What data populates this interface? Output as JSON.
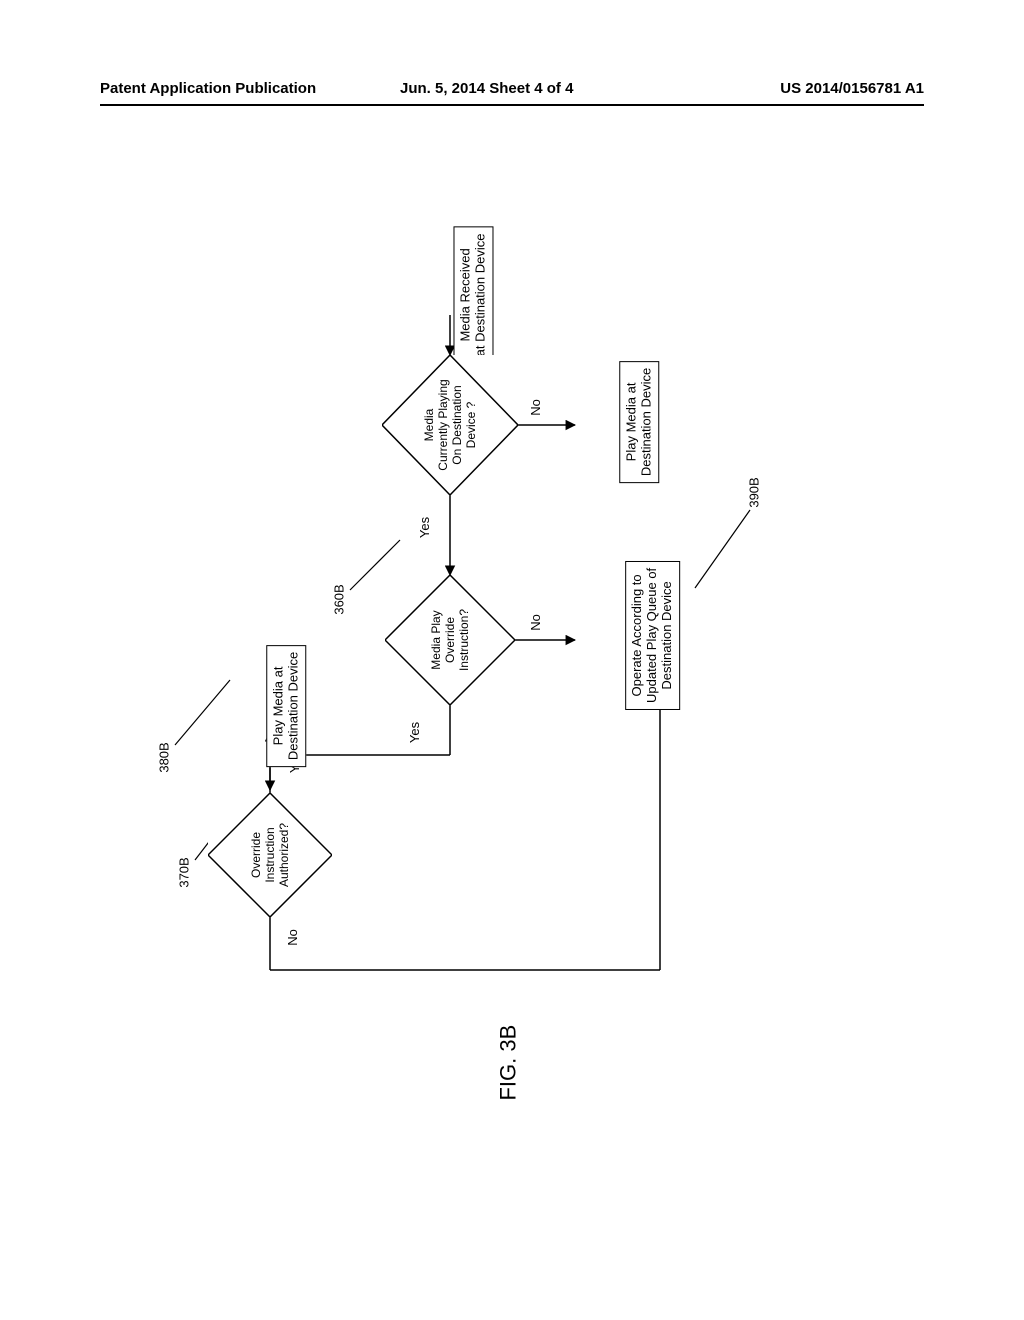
{
  "header": {
    "left": "Patent Application Publication",
    "center": "Jun. 5, 2014   Sheet 4 of 4",
    "right": "US 2014/0156781 A1"
  },
  "figure_label": "FIG. 3B",
  "nodes": {
    "start": "Media Received\nat Destination Device",
    "d1": "Media\nCurrently Playing\nOn Destination\nDevice ?",
    "play_no": "Play Media at\nDestination Device",
    "d2": "Media Play\nOverride\nInstruction?",
    "operate": "Operate According to\nUpdated Play Queue of\nDestination Device",
    "d3": "Override\nInstruction\nAuthorized?",
    "play_yes": "Play Media at\nDestination Device"
  },
  "edge_labels": {
    "yes": "Yes",
    "no": "No"
  },
  "refs": {
    "r360B": "360B",
    "r370B": "370B",
    "r380B": "380B",
    "r390B": "390B"
  }
}
